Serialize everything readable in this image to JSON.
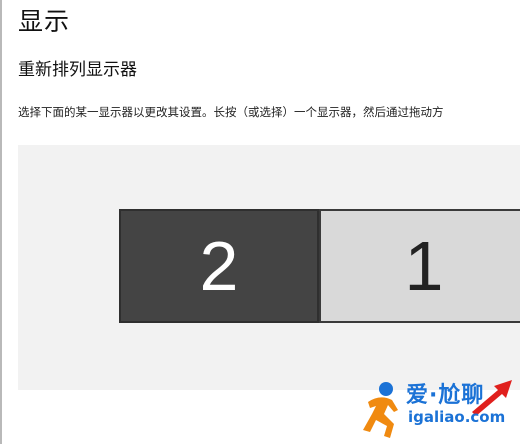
{
  "page": {
    "title": "显示",
    "section_title": "重新排列显示器",
    "description": "选择下面的某一显示器以更改其设置。长按（或选择）一个显示器，然后通过拖动方"
  },
  "monitors": [
    {
      "number": "2",
      "state": "selected"
    },
    {
      "number": "1",
      "state": "unselected"
    }
  ],
  "watermark": {
    "brand": "爱·尬聊",
    "url": "igaliao.com",
    "icon": "runner-icon",
    "arrow_icon": "red-arrow-icon"
  },
  "colors": {
    "selected_monitor": "#444444",
    "unselected_monitor": "#d9d9d9",
    "arrange_background": "#f2f2f2",
    "watermark_blue": "#1b72d6",
    "arrow_red": "#e0201d"
  }
}
